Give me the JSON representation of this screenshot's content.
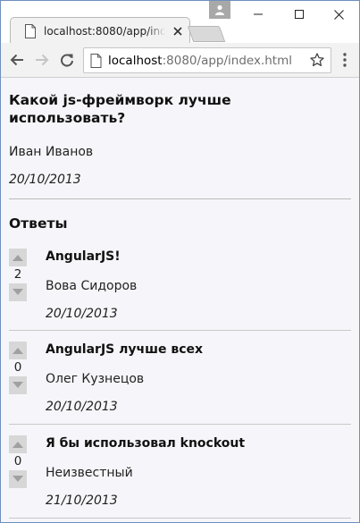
{
  "browser": {
    "tab_title": "localhost:8080/app/index.html",
    "url_host": "localhost",
    "url_path": ":8080/app/index.html"
  },
  "question": {
    "title": "Какой js-фреймворк лучше использовать?",
    "author": "Иван Иванов",
    "date": "20/10/2013"
  },
  "answers_heading": "Ответы",
  "answers": [
    {
      "title": "AngularJS!",
      "votes": "2",
      "author": "Вова Сидоров",
      "date": "20/10/2013"
    },
    {
      "title": "AngularJS лучше всех",
      "votes": "0",
      "author": "Олег Кузнецов",
      "date": "20/10/2013"
    },
    {
      "title": "Я бы использовал knockout",
      "votes": "0",
      "author": "Неизвестный",
      "date": "21/10/2013"
    }
  ],
  "colors": {
    "page_background": "#f6f6fa",
    "vote_button": "#d7d7d7",
    "window_border": "#6f8fc0"
  },
  "icons": {
    "tab_favicon": "page-icon",
    "tab_close": "close-icon",
    "back": "arrow-left-icon",
    "forward": "arrow-right-icon",
    "reload": "reload-icon",
    "site_info": "page-icon",
    "bookmark": "star-icon",
    "menu": "more-vertical-icon",
    "vote_up": "triangle-up-icon",
    "vote_down": "triangle-down-icon",
    "profile": "person-icon"
  }
}
